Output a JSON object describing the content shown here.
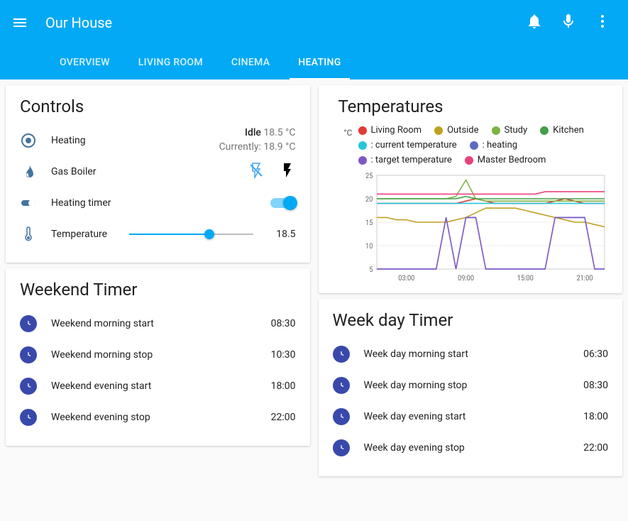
{
  "app": {
    "title": "Our House"
  },
  "tabs": [
    "OVERVIEW",
    "LIVING ROOM",
    "CINEMA",
    "HEATING"
  ],
  "active_tab": 3,
  "controls": {
    "title": "Controls",
    "heating_label": "Heating",
    "heating_status_1": "Idle",
    "heating_status_temp": " 18.5 °C",
    "heating_status_2": "Currently: 18.9 °C",
    "boiler_label": "Gas Boiler",
    "timer_label": "Heating timer",
    "timer_on": true,
    "temp_label": "Temperature",
    "temp_value": "18.5",
    "temp_slider_pct": 65
  },
  "weekend_timer": {
    "title": "Weekend Timer",
    "rows": [
      {
        "label": "Weekend morning start",
        "value": "08:30"
      },
      {
        "label": "Weekend morning stop",
        "value": "10:30"
      },
      {
        "label": "Weekend evening start",
        "value": "18:00"
      },
      {
        "label": "Weekend evening stop",
        "value": "22:00"
      }
    ]
  },
  "weekday_timer": {
    "title": "Week day Timer",
    "rows": [
      {
        "label": "Week day morning start",
        "value": "06:30"
      },
      {
        "label": "Week day morning stop",
        "value": "08:30"
      },
      {
        "label": "Week day evening start",
        "value": "18:00"
      },
      {
        "label": "Week day evening stop",
        "value": "22:00"
      }
    ]
  },
  "temperatures": {
    "title": "Temperatures",
    "unit": "°C",
    "legend": [
      {
        "name": "Living Room",
        "color": "#e53935"
      },
      {
        "name": "Outside",
        "color": "#c0a020"
      },
      {
        "name": "Study",
        "color": "#7cb342"
      },
      {
        "name": "Kitchen",
        "color": "#43a047"
      },
      {
        "name": ": current temperature",
        "color": "#26c6da"
      },
      {
        "name": ": heating",
        "color": "#5c6bc0"
      },
      {
        "name": ": target temperature",
        "color": "#7e57c2"
      },
      {
        "name": "Master Bedroom",
        "color": "#ec407a"
      }
    ]
  },
  "chart_data": {
    "type": "line",
    "title": "Temperatures",
    "ylabel": "°C",
    "ylim": [
      5,
      25
    ],
    "y_ticks": [
      5,
      10,
      15,
      20,
      25
    ],
    "x_ticks": [
      "03:00",
      "09:00",
      "15:00",
      "21:00"
    ],
    "x_hours": [
      0,
      1,
      2,
      3,
      4,
      5,
      6,
      7,
      8,
      9,
      10,
      11,
      12,
      13,
      14,
      15,
      16,
      17,
      18,
      19,
      20,
      21,
      22,
      23
    ],
    "series": [
      {
        "name": "Living Room",
        "color": "#e53935",
        "values": [
          19,
          19,
          19,
          19,
          19,
          19,
          19,
          19,
          19,
          19.5,
          20,
          19.5,
          19,
          19,
          19,
          19,
          19,
          19,
          19.5,
          20,
          19.5,
          19,
          19,
          19
        ]
      },
      {
        "name": "Outside",
        "color": "#c0a020",
        "values": [
          16,
          16,
          15.5,
          15.5,
          15,
          15,
          15,
          15,
          15.5,
          16,
          17,
          18,
          18,
          18,
          18,
          17.5,
          17,
          16.5,
          16,
          15.5,
          15,
          15,
          14.5,
          14
        ]
      },
      {
        "name": "Study",
        "color": "#7cb342",
        "values": [
          20,
          20,
          20,
          20,
          20,
          20,
          20,
          20,
          20.5,
          24,
          20,
          19.5,
          19.5,
          19.5,
          19.5,
          19.5,
          19.5,
          19.5,
          19.5,
          19.5,
          19.5,
          19.5,
          19.5,
          19.5
        ]
      },
      {
        "name": "Kitchen",
        "color": "#43a047",
        "values": [
          20,
          20,
          20,
          20,
          20,
          20,
          20,
          20,
          20,
          20.5,
          20,
          20,
          20,
          20,
          20,
          20,
          20,
          20,
          20,
          20,
          20,
          20,
          20,
          20
        ]
      },
      {
        "name": ": current temperature",
        "color": "#26c6da",
        "values": [
          19,
          19,
          19,
          19,
          19,
          19,
          19,
          19,
          19,
          19,
          19,
          19,
          19,
          19,
          19,
          19,
          19,
          19,
          19,
          19,
          19,
          19,
          19,
          19
        ]
      },
      {
        "name": ": heating",
        "color": "#5c6bc0",
        "values": [
          5,
          5,
          5,
          5,
          5,
          5,
          5,
          16,
          5,
          16,
          16,
          5,
          5,
          5,
          5,
          5,
          5,
          5,
          16,
          16,
          16,
          16,
          5,
          5
        ]
      },
      {
        "name": ": target temperature",
        "color": "#7e57c2",
        "values": [
          5,
          5,
          5,
          5,
          5,
          5,
          5,
          16,
          5,
          16,
          16,
          5,
          5,
          5,
          5,
          5,
          5,
          5,
          16,
          16,
          16,
          16,
          5,
          5
        ]
      },
      {
        "name": "Master Bedroom",
        "color": "#ec407a",
        "values": [
          21,
          21,
          21,
          21,
          21,
          21,
          21,
          21,
          21,
          21,
          21,
          21,
          21,
          21,
          21,
          21,
          21,
          21.5,
          21.5,
          21.5,
          21.5,
          21.5,
          21.5,
          21.5
        ]
      }
    ]
  }
}
